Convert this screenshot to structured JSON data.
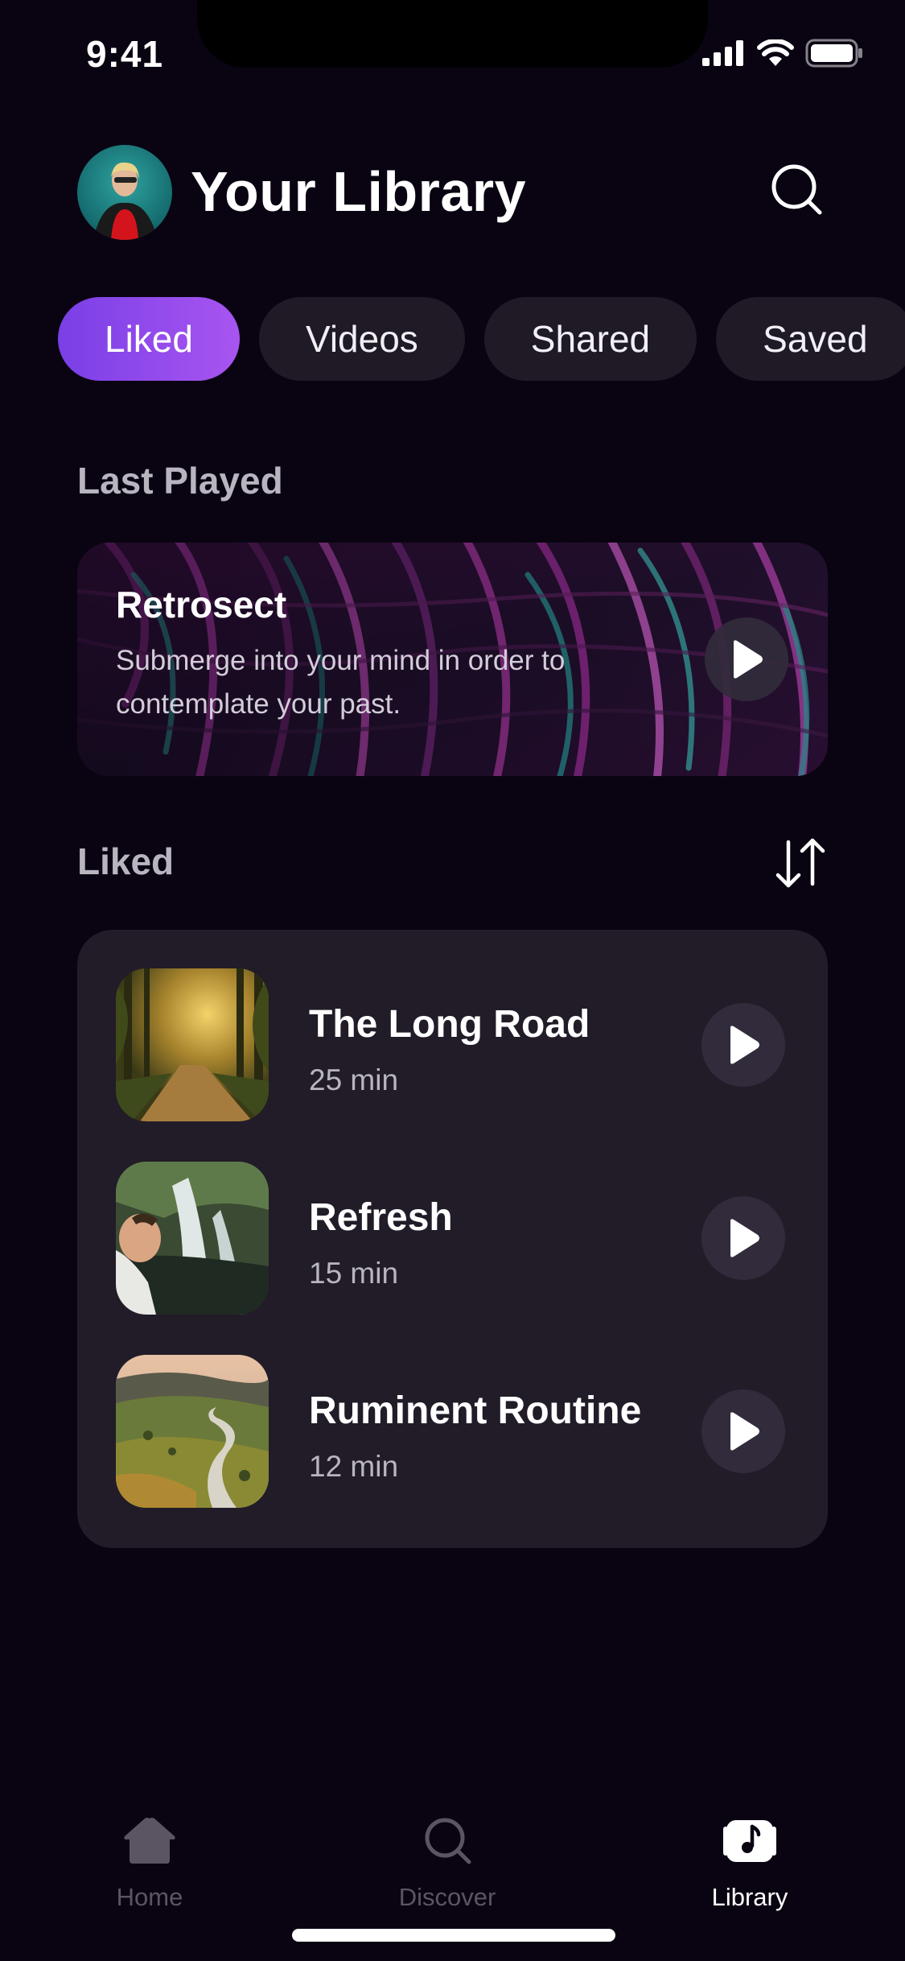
{
  "status_bar": {
    "time": "9:41"
  },
  "header": {
    "title": "Your Library",
    "avatar_icon": "avatar",
    "search_icon": "search-icon"
  },
  "tabs": [
    {
      "label": "Liked",
      "active": true
    },
    {
      "label": "Videos",
      "active": false
    },
    {
      "label": "Shared",
      "active": false
    },
    {
      "label": "Saved",
      "active": false
    }
  ],
  "last_played": {
    "section_label": "Last Played",
    "title": "Retrosect",
    "description": "Submerge into your mind in order to contemplate your past."
  },
  "liked": {
    "section_label": "Liked",
    "items": [
      {
        "title": "The Long Road",
        "duration": "25 min"
      },
      {
        "title": "Refresh",
        "duration": "15 min"
      },
      {
        "title": "Ruminent Routine",
        "duration": "12 min"
      }
    ]
  },
  "bottom_nav": [
    {
      "label": "Home",
      "icon": "home-icon",
      "active": false
    },
    {
      "label": "Discover",
      "icon": "search-icon",
      "active": false
    },
    {
      "label": "Library",
      "icon": "library-icon",
      "active": true
    }
  ],
  "colors": {
    "accent_start": "#7a3fe6",
    "accent_end": "#a855f0",
    "background": "#0a0412",
    "panel": "#211c28"
  }
}
